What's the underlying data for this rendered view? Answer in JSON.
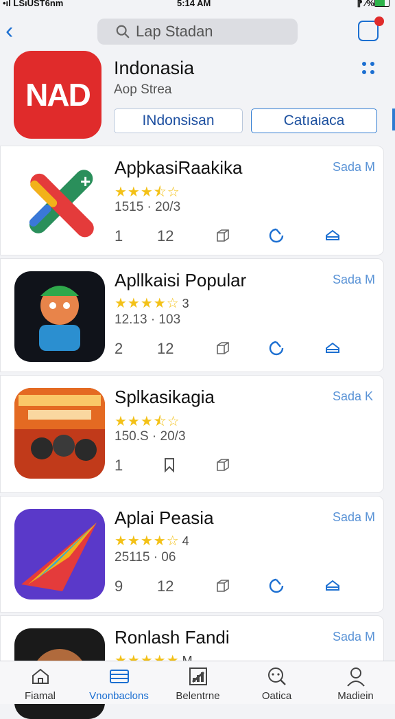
{
  "status_bar": {
    "carrier": "•ıl LSıUSТ6nm",
    "time": "5:14 AM",
    "right": "⁋ ⁄%"
  },
  "header": {
    "search_placeholder": "Lap Stadan"
  },
  "featured": {
    "icon_text": "NAD",
    "title": "Indonasia",
    "subtitle": "Aop Strea",
    "buttons": [
      "INdonsisan",
      "Catıaiaca"
    ]
  },
  "apps": [
    {
      "name": "ApþkasiRaakika",
      "get": "Sada M",
      "rating": 3.5,
      "rating_text": "",
      "meta": "1515 · 20/3",
      "row": [
        "1",
        "12"
      ],
      "icons": [
        "box-icon",
        "refresh-icon",
        "home-icon"
      ],
      "icon_bg": "#ffffff"
    },
    {
      "name": "Apllkaisi Popular",
      "get": "Sada M",
      "rating": 4,
      "rating_text": "3",
      "meta": "12.13 · 103",
      "row": [
        "2",
        "12"
      ],
      "icons": [
        "box-icon",
        "refresh-icon",
        "home-icon"
      ],
      "icon_bg": "#10131a"
    },
    {
      "name": "Splkasikagia",
      "get": "Sada K",
      "rating": 3.5,
      "rating_text": "",
      "meta": "150.S · 20/3",
      "row": [
        "1",
        ""
      ],
      "icons": [
        "bookmark-icon",
        "box-icon"
      ],
      "icon_bg": "#c13a1a"
    },
    {
      "name": "Aplai Peasia",
      "get": "Sada M",
      "rating": 4,
      "rating_text": "4",
      "meta": "25115 · 06",
      "row": [
        "9",
        "12"
      ],
      "icons": [
        "box-icon",
        "refresh-icon",
        "home-icon"
      ],
      "icon_bg": "#5a39c9"
    },
    {
      "name": "Ronlash Fandi",
      "get": "Sada M",
      "rating": 5,
      "rating_text": "M",
      "meta": "",
      "row": [
        "",
        ""
      ],
      "icons": [],
      "icon_bg": "#1a1a1a"
    }
  ],
  "tabs": [
    {
      "label": "Fiamal",
      "icon": "home-icon",
      "active": false
    },
    {
      "label": "Vnonbaclons",
      "icon": "list-icon",
      "active": true
    },
    {
      "label": "Belentrne",
      "icon": "chart-icon",
      "active": false
    },
    {
      "label": "Oatica",
      "icon": "search-icon",
      "active": false
    },
    {
      "label": "Madiein",
      "icon": "profile-icon",
      "active": false
    }
  ],
  "colors": {
    "accent": "#1c6fd1",
    "star": "#f3c117",
    "brand_red": "#e02b2b"
  }
}
